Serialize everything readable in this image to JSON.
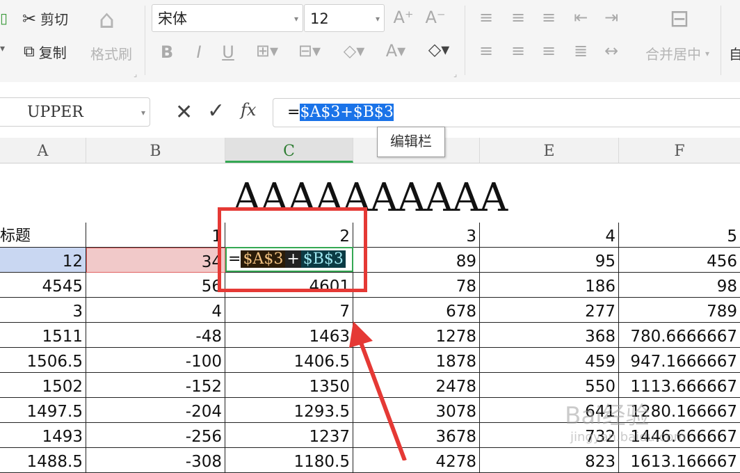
{
  "ribbon": {
    "cut_label": "剪切",
    "copy_label": "复制",
    "format_painter_label": "格式刷",
    "font_name": "宋体",
    "font_size": "12",
    "merge_center_label": "合并居中",
    "auto_wrap_label": "自"
  },
  "formula_bar": {
    "name_box": "UPPER",
    "fx_label": "fx",
    "formula_prefix": "=",
    "formula_selected": "$A$3+$B$3",
    "tooltip": "编辑栏"
  },
  "columns": [
    "A",
    "B",
    "C",
    "D",
    "E",
    "F"
  ],
  "sheet_title": "AAAAAAAAAA",
  "header_row": [
    "标题",
    "1",
    "2",
    "3",
    "4",
    "5"
  ],
  "rows": [
    [
      "12",
      "34",
      "",
      "89",
      "95",
      "456"
    ],
    [
      "4545",
      "56",
      "4601",
      "78",
      "186",
      "98"
    ],
    [
      "3",
      "4",
      "7",
      "678",
      "277",
      "789"
    ],
    [
      "1511",
      "-48",
      "1463",
      "1278",
      "368",
      "780.6666667"
    ],
    [
      "1506.5",
      "-100",
      "1406.5",
      "1878",
      "459",
      "947.1666667"
    ],
    [
      "1502",
      "-152",
      "1350",
      "2478",
      "550",
      "1113.666667"
    ],
    [
      "1497.5",
      "-204",
      "1293.5",
      "3078",
      "641",
      "1280.166667"
    ],
    [
      "1493",
      "-256",
      "1237",
      "3678",
      "732",
      "1446.666667"
    ],
    [
      "1488.5",
      "-308",
      "1180.5",
      "4278",
      "823",
      "1613.166667"
    ]
  ],
  "edit_cell": {
    "prefix": "=",
    "ref1": "$A$3",
    "op": "+",
    "ref2": "$B$3"
  },
  "watermark": "Bai经验",
  "watermark_sub": "jingyan.baidu.com",
  "colors": {
    "accent_red": "#e53935",
    "active_green": "#34a853",
    "selection_blue": "#1a73e8"
  }
}
